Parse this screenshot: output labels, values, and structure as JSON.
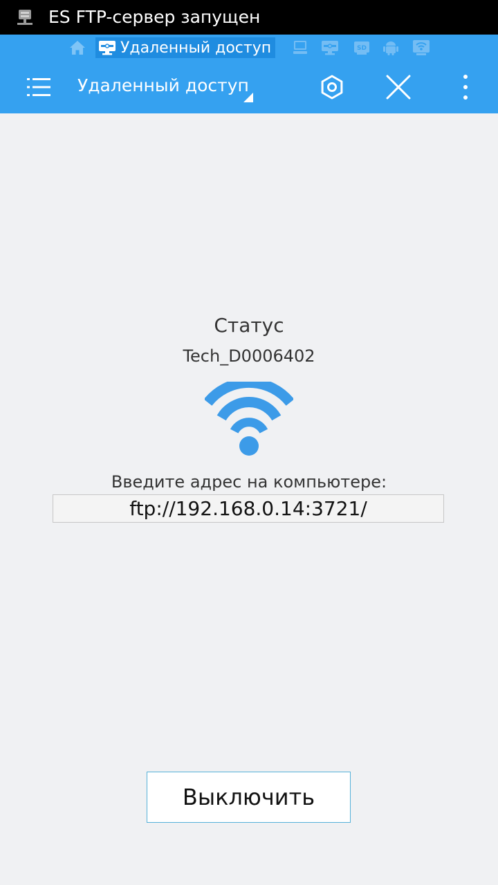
{
  "notification": {
    "icon": "ftp-server-icon",
    "text": "ES FTP-сервер запущен"
  },
  "breadcrumbs": {
    "active_label": "Удаленный доступ",
    "items": [
      "home-icon",
      "remote-access-icon",
      "computer-icon",
      "network-icon",
      "sd-card-icon",
      "android-icon",
      "wifi-share-icon"
    ]
  },
  "toolbar": {
    "title": "Удаленный доступ",
    "icons": [
      "menu-icon",
      "settings-icon",
      "close-icon",
      "more-icon"
    ]
  },
  "status": {
    "title": "Статус",
    "network_name": "Tech_D0006402",
    "icon": "wifi-icon",
    "instruction": "Введите адрес на компьютере:",
    "address": "ftp://192.168.0.14:3721/"
  },
  "actions": {
    "turn_off_label": "Выключить"
  },
  "colors": {
    "header": "#35a1f0",
    "active_crumb": "#1f8ce0",
    "wifi": "#3c9be8",
    "background": "#f0f1f3",
    "button_border": "#54b0d8"
  }
}
